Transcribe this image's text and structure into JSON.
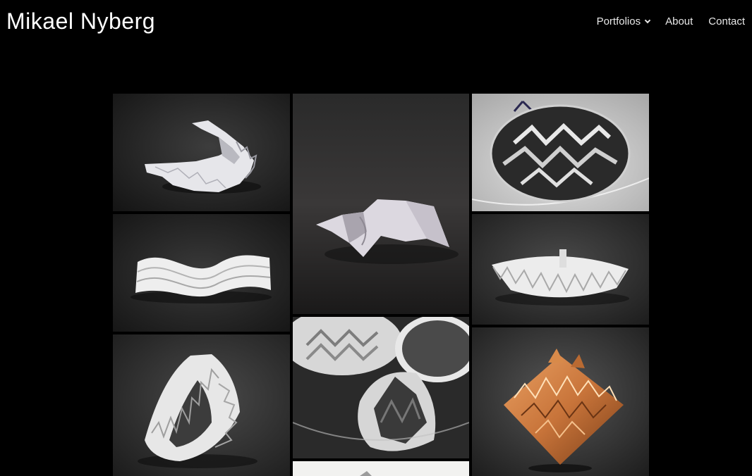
{
  "header": {
    "site_title": "Mikael Nyberg",
    "nav": [
      {
        "label": "Portfolios",
        "has_dropdown": true,
        "icon": "chevron-down-icon"
      },
      {
        "label": "About",
        "has_dropdown": false
      },
      {
        "label": "Contact",
        "has_dropdown": false
      }
    ]
  },
  "colors": {
    "background": "#000000",
    "text": "#ffffff",
    "copper": "#c8743a"
  },
  "gallery": {
    "tiles": [
      {
        "subject": "white folded paper spiral on dark background"
      },
      {
        "subject": "white curved folded paper sculpture on dark background"
      },
      {
        "subject": "dark chevron-patterned metallic disc on light dish"
      },
      {
        "subject": "white wavy corrugated paper strip"
      },
      {
        "subject": "white pleated paper fan"
      },
      {
        "subject": "white zigzag folded paper loop"
      },
      {
        "subject": "chevron folded discs and dark textured fold in glass dish"
      },
      {
        "subject": "copper faceted origami diamond"
      },
      {
        "subject": "partially visible light image"
      }
    ]
  }
}
